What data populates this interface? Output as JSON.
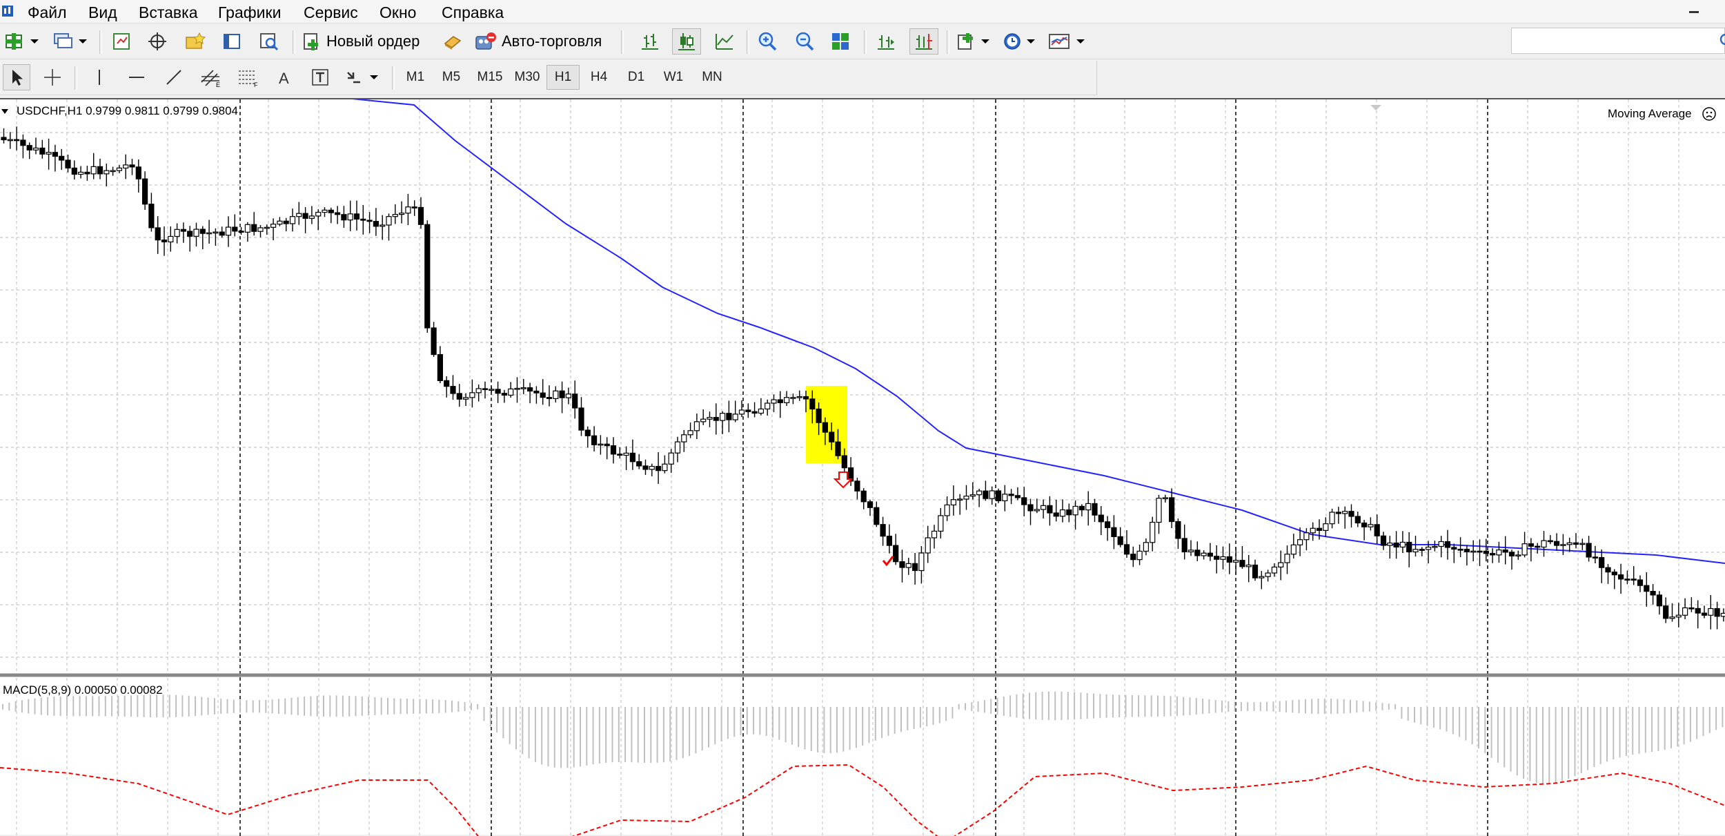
{
  "menu": {
    "items": [
      "Файл",
      "Вид",
      "Вставка",
      "Графики",
      "Сервис",
      "Окно",
      "Справка"
    ]
  },
  "toolbar": {
    "new_order_label": "Новый ордер",
    "autotrade_label": "Авто-торговля"
  },
  "timeframes": {
    "items": [
      "M1",
      "M5",
      "M15",
      "M30",
      "H1",
      "H4",
      "D1",
      "W1",
      "MN"
    ],
    "active": "H1"
  },
  "chart": {
    "symbol_line": "USDCHF,H1  0.9799 0.9811 0.9799 0.9804",
    "indicator_label": "Moving Average",
    "macd_label": "MACD(5,8,9) 0.00050 0.00082",
    "colors": {
      "bull_candle": "#ffffff",
      "bear_candle": "#000000",
      "moving_average": "#2323ff",
      "macd_signal": "#ff0000",
      "macd_histogram": "#c0c0c0",
      "highlight": "#ffff00",
      "sell_arrow": "#ff0000",
      "check_mark": "#ff0000",
      "grid": "#c8c8c8"
    }
  }
}
